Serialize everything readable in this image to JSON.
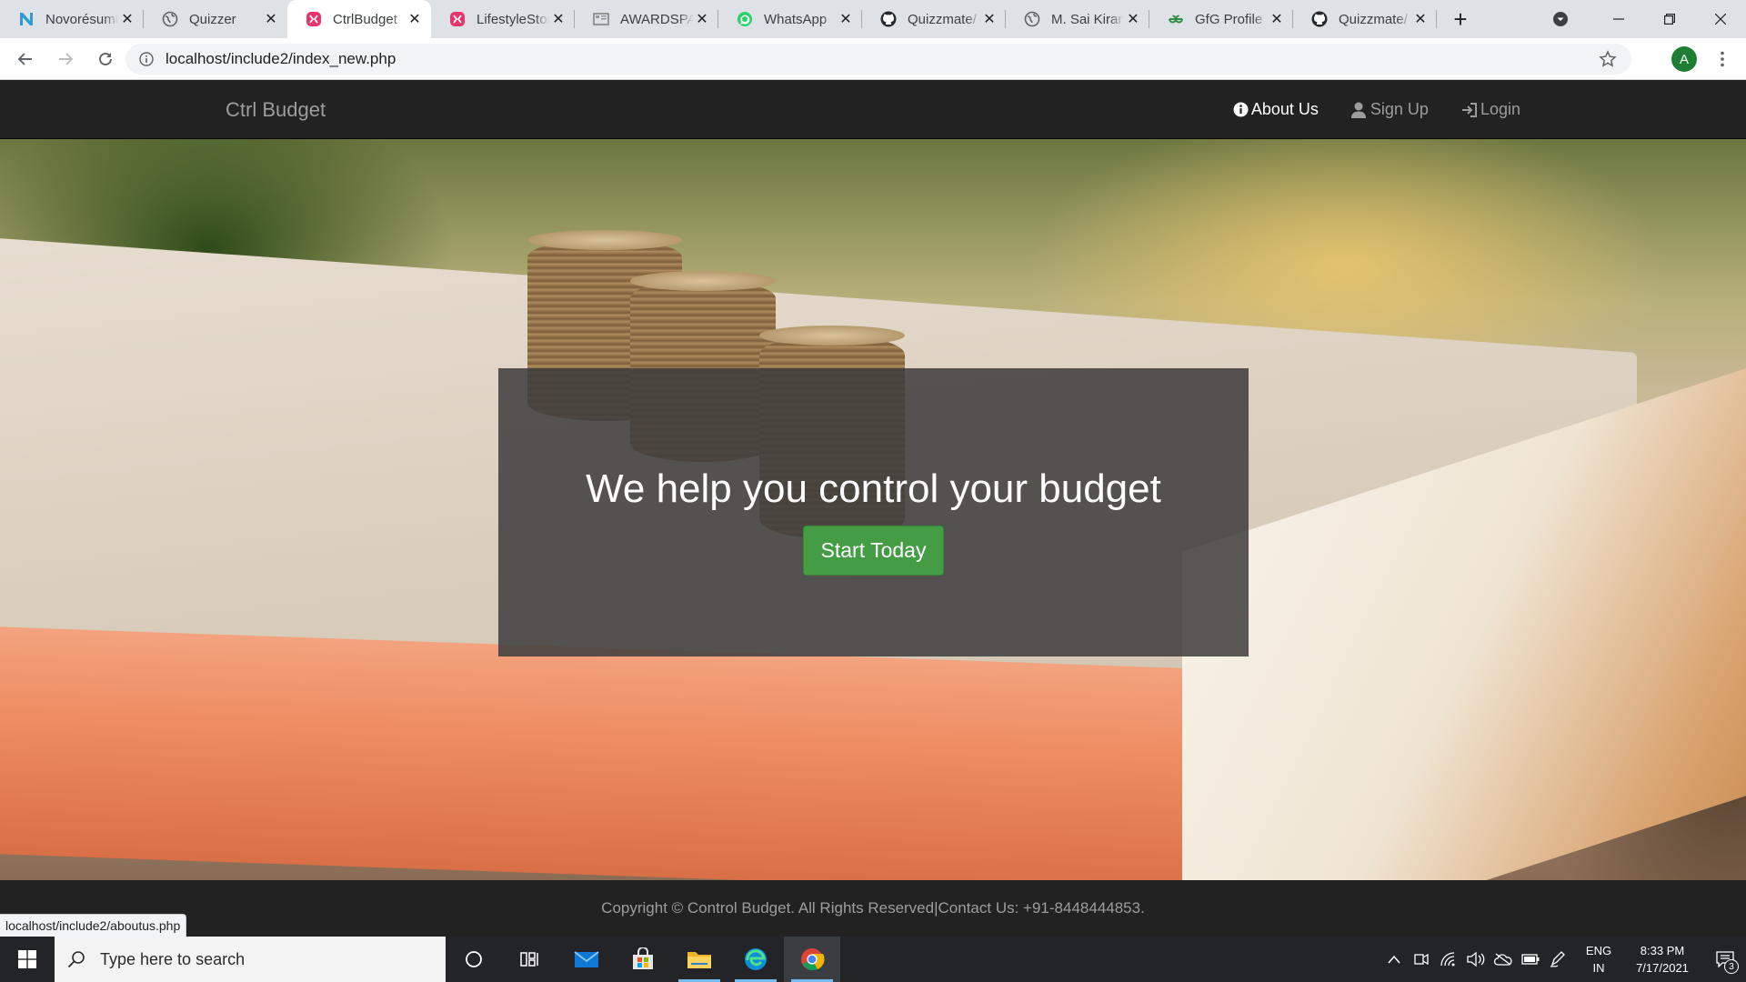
{
  "browser": {
    "tabs": [
      {
        "title": "Novorésumé",
        "icon": "novoresume-icon"
      },
      {
        "title": "Quizzer",
        "icon": "globe-icon"
      },
      {
        "title": "CtrlBudget",
        "icon": "xampp-icon",
        "active": true
      },
      {
        "title": "LifestyleStore",
        "icon": "xampp-icon"
      },
      {
        "title": "AWARDSPACE",
        "icon": "page-icon"
      },
      {
        "title": "WhatsApp",
        "icon": "whatsapp-icon"
      },
      {
        "title": "Quizzmate/",
        "icon": "github-icon"
      },
      {
        "title": "M. Sai Kiran",
        "icon": "globe-icon"
      },
      {
        "title": "GfG Profile",
        "icon": "gfg-icon"
      },
      {
        "title": "Quizzmate/",
        "icon": "github-icon"
      }
    ],
    "url": "localhost/include2/index_new.php",
    "profile_initial": "A",
    "status_url": "localhost/include2/aboutus.php"
  },
  "site": {
    "brand": "Ctrl Budget",
    "nav": {
      "about": "About Us",
      "signup": "Sign Up",
      "login": "Login"
    },
    "hero": {
      "title": "We help you control your budget",
      "cta": "Start Today"
    },
    "footer": "Copyright © Control Budget. All Rights Reserved|Contact Us: +91-8448444853."
  },
  "taskbar": {
    "search_placeholder": "Type here to search",
    "lang_line1": "ENG",
    "lang_line2": "IN",
    "time": "8:33 PM",
    "date": "7/17/2021",
    "notification_count": "3"
  },
  "colors": {
    "navbar": "#222222",
    "cta_green": "#449d44",
    "taskbar": "#222427"
  }
}
